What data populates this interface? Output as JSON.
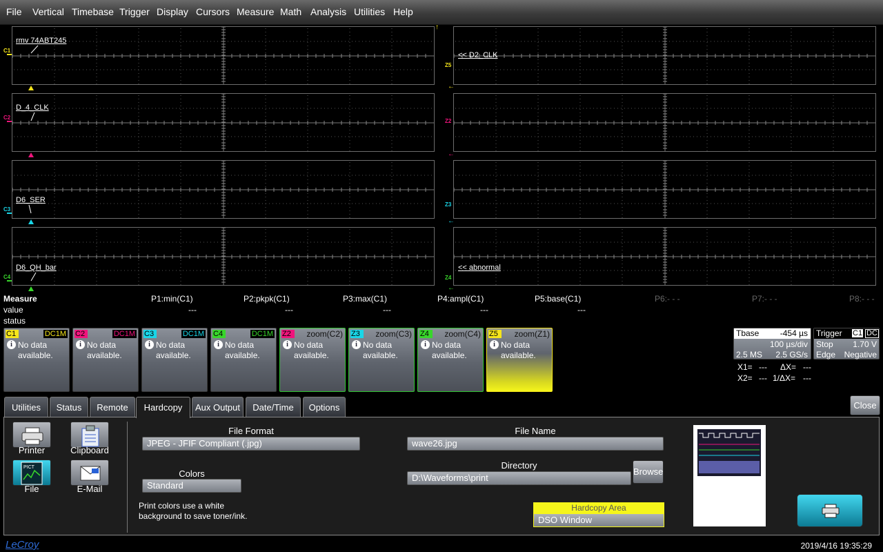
{
  "menu": [
    "File",
    "Vertical",
    "Timebase",
    "Trigger",
    "Display",
    "Cursors",
    "Measure",
    "Math",
    "Analysis",
    "Utilities",
    "Help"
  ],
  "grids": {
    "c1_label": "rmv 74ABT245",
    "c2_label": "D_4_CLK",
    "c3_label": "D6_SER",
    "c4_label": "D6_QH_bar",
    "z5_label": "<< D2_CLK",
    "z4_label": "<< abnormal",
    "markers": {
      "c1": "C1",
      "c2": "C2",
      "c3": "C3",
      "c4": "C4",
      "z5": "Z5",
      "z2": "Z2",
      "z3": "Z3",
      "z4": "Z4"
    }
  },
  "measure": {
    "title": "Measure",
    "rows": [
      "value",
      "status"
    ],
    "params": [
      "P1:min(C1)",
      "P2:pkpk(C1)",
      "P3:max(C1)",
      "P4:ampl(C1)",
      "P5:base(C1)",
      "P6:- - -",
      "P7:- - -",
      "P8:- - -"
    ],
    "values": [
      "---",
      "---",
      "---",
      "---",
      "---"
    ]
  },
  "channels": [
    {
      "tag": "C1",
      "label": "DC1M",
      "color": "#f5e51b",
      "text": "No data available."
    },
    {
      "tag": "C2",
      "label": "DC1M",
      "color": "#f0147c",
      "text": "No data available."
    },
    {
      "tag": "C3",
      "label": "DC1M",
      "color": "#19d6e8",
      "text": "No data available."
    },
    {
      "tag": "C4",
      "label": "DC1M",
      "color": "#38d62b",
      "text": "No data available."
    },
    {
      "tag": "Z2",
      "label": "zoom(C2)",
      "color": "#f0147c",
      "text": "No data available."
    },
    {
      "tag": "Z3",
      "label": "zoom(C3)",
      "color": "#19d6e8",
      "text": "No data available."
    },
    {
      "tag": "Z4",
      "label": "zoom(C4)",
      "color": "#38d62b",
      "text": "No data available."
    },
    {
      "tag": "Z5",
      "label": "zoom(Z1)",
      "color": "#f5e51b",
      "text": "No data available."
    }
  ],
  "timebase": {
    "title": "Tbase",
    "delay": "-454 µs",
    "div": "100 µs/div",
    "samples": "2.5 MS",
    "rate": "2.5 GS/s"
  },
  "trigger": {
    "title": "Trigger",
    "chan1": "C1",
    "chan2": "DC",
    "mode": "Stop",
    "level": "1.70 V",
    "type": "Edge",
    "slope": "Negative"
  },
  "cursors": {
    "x1": "X1=",
    "x1v": "---",
    "dx": "ΔX=",
    "dxv": "---",
    "x2": "X2=",
    "x2v": "---",
    "idx": "1/ΔX=",
    "idxv": "---"
  },
  "tabs": [
    "Utilities",
    "Status",
    "Remote",
    "Hardcopy",
    "Aux Output",
    "Date/Time",
    "Options"
  ],
  "close_label": "Close",
  "hardcopy": {
    "printer": "Printer",
    "clipboard": "Clipboard",
    "file": "File",
    "email": "E-Mail",
    "file_format_label": "File Format",
    "file_format": "JPEG - JFIF Compliant (.jpg)",
    "colors_label": "Colors",
    "colors": "Standard",
    "note": "Print colors use a white background to save toner/ink.",
    "file_name_label": "File Name",
    "file_name": "wave26.jpg",
    "directory_label": "Directory",
    "directory": "D:\\Waveforms\\print",
    "browse": "Browse",
    "area_label": "Hardcopy Area",
    "area": "DSO Window",
    "pict_label": "PICT"
  },
  "status": {
    "brand": "LeCroy",
    "datetime": "2019/4/16 19:35:29"
  },
  "colors": {
    "c1": "#f5e51b",
    "c2": "#f0147c",
    "c3": "#19d6e8",
    "c4": "#38d62b"
  }
}
